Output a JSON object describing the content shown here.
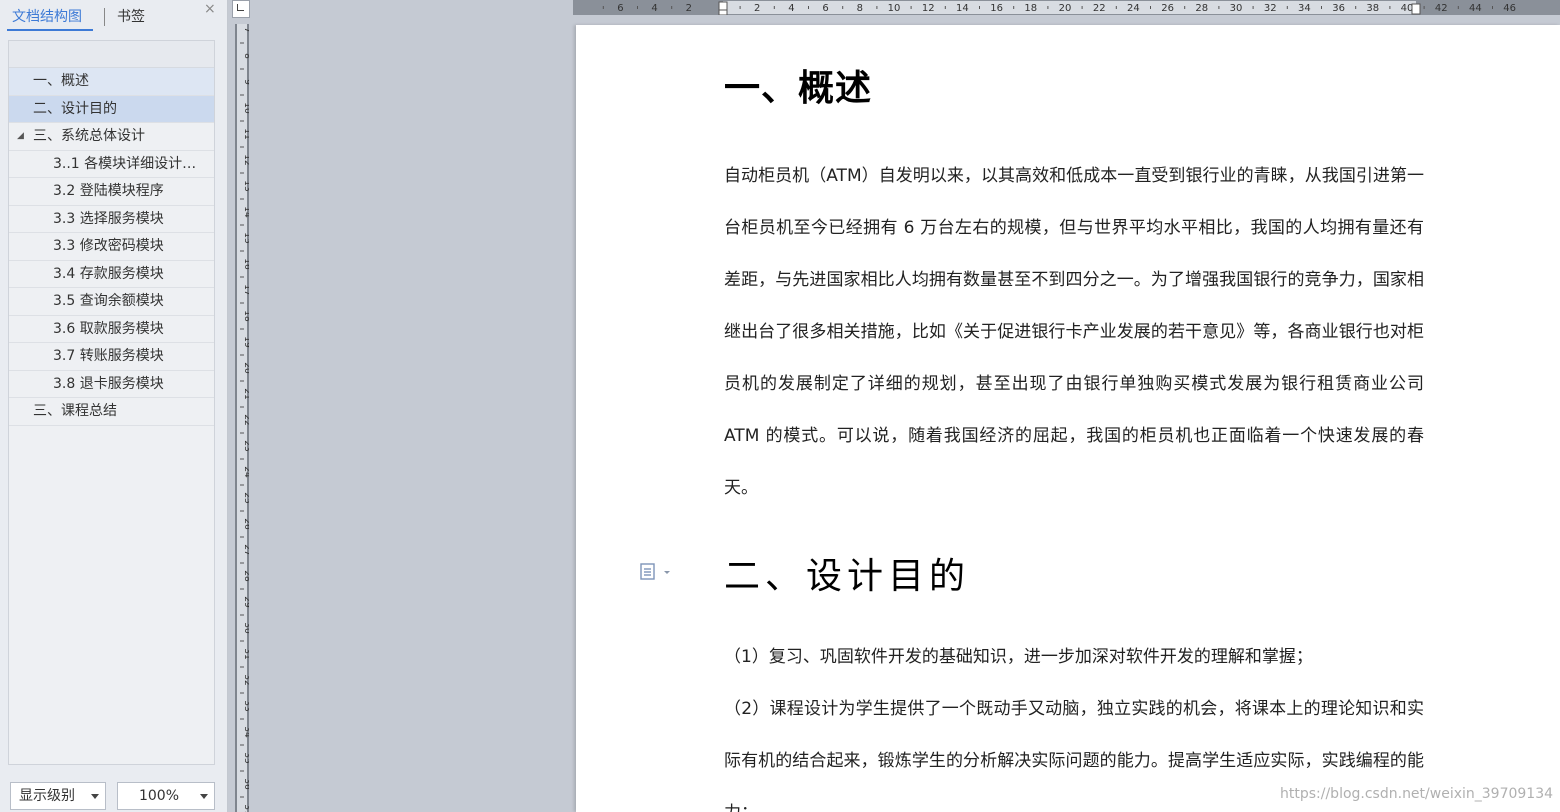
{
  "nav": {
    "tabs": {
      "outline": "文档结构图",
      "bookmark": "书签"
    },
    "close_icon": "×",
    "items": [
      {
        "label": "一、概述",
        "level": 1
      },
      {
        "label": "二、设计目的",
        "level": 1
      },
      {
        "label": "三、系统总体设计",
        "level": 1,
        "expanded": true
      },
      {
        "label": "3..1 各模块详细设计…",
        "level": 2
      },
      {
        "label": "3.2 登陆模块程序",
        "level": 2
      },
      {
        "label": "3.3 选择服务模块",
        "level": 2
      },
      {
        "label": "3.3 修改密码模块",
        "level": 2
      },
      {
        "label": "3.4 存款服务模块",
        "level": 2
      },
      {
        "label": "3.5 查询余额模块",
        "level": 2
      },
      {
        "label": "3.6 取款服务模块",
        "level": 2
      },
      {
        "label": "3.7 转账服务模块",
        "level": 2
      },
      {
        "label": "3.8 退卡服务模块",
        "level": 2
      },
      {
        "label": "三、课程总结",
        "level": 1
      }
    ],
    "level_combo": "显示级别",
    "zoom_combo": "100%"
  },
  "vruler": {
    "labels": [
      "7",
      "8",
      "9",
      "10",
      "11",
      "12",
      "13",
      "14",
      "15",
      "16",
      "17",
      "18",
      "19",
      "20",
      "21",
      "22",
      "23",
      "24",
      "25",
      "26",
      "27",
      "28",
      "29",
      "30",
      "31",
      "32",
      "33",
      "34",
      "35",
      "36",
      "37"
    ]
  },
  "hruler": {
    "labels": [
      "6",
      "4",
      "2",
      "2",
      "4",
      "6",
      "8",
      "10",
      "12",
      "14",
      "16",
      "18",
      "20",
      "22",
      "24",
      "26",
      "28",
      "30",
      "32",
      "34",
      "36",
      "38",
      "40",
      "42",
      "44",
      "46"
    ]
  },
  "document": {
    "heading1": "一、概述",
    "para1": "自动柜员机（ATM）自发明以来，以其高效和低成本一直受到银行业的青睐，从我国引进第一台柜员机至今已经拥有 6 万台左右的规模，但与世界平均水平相比，我国的人均拥有量还有差距，与先进国家相比人均拥有数量甚至不到四分之一。为了增强我国银行的竞争力，国家相继出台了很多相关措施，比如《关于促进银行卡产业发展的若干意见》等，各商业银行也对柜员机的发展制定了详细的规划，甚至出现了由银行单独购买模式发展为银行租赁商业公司 ATM 的模式。可以说，随着我国经济的屈起，我国的柜员机也正面临着一个快速发展的春天。",
    "heading2": "二、设计目的",
    "para2": "（1）复习、巩固软件开发的基础知识，进一步加深对软件开发的理解和掌握；",
    "para3": "（2）课程设计为学生提供了一个既动手又动脑，独立实践的机会，将课本上的理论知识和实际有机的结合起来，锻炼学生的分析解决实际问题的能力。提高学生适应实际，实践编程的能力；"
  },
  "watermark": "https://blog.csdn.net/weixin_39709134",
  "colors": {
    "accent": "#3d7ad6",
    "ruler": "#7f858e",
    "canvas": "#c5cad3"
  }
}
